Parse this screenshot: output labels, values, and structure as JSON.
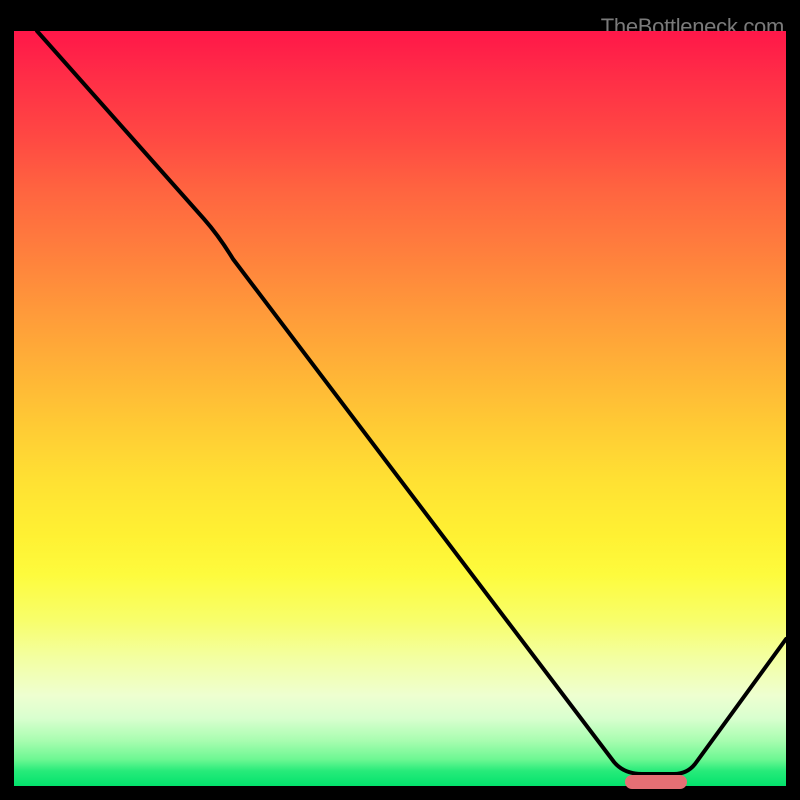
{
  "attribution": "TheBottleneck.com",
  "colors": {
    "curve": "#000000",
    "marker": "#e56f74",
    "gradient_top": "#ff1749",
    "gradient_bottom": "#03e26c"
  },
  "chart_data": {
    "type": "line",
    "title": "",
    "xlabel": "",
    "ylabel": "",
    "xlim": [
      0,
      100
    ],
    "ylim": [
      0,
      100
    ],
    "series": [
      {
        "name": "bottleneck-curve",
        "x": [
          3,
          25,
          80,
          86,
          100
        ],
        "values": [
          100,
          75,
          2,
          2,
          21
        ]
      }
    ],
    "marker": {
      "x_start": 79,
      "x_end": 87,
      "y": 1.5
    },
    "gradient_stops": [
      {
        "pct": 0,
        "color": "#ff1749"
      },
      {
        "pct": 25,
        "color": "#ff7e3d"
      },
      {
        "pct": 50,
        "color": "#ffcd34"
      },
      {
        "pct": 75,
        "color": "#f8fe6a"
      },
      {
        "pct": 95,
        "color": "#6cf792"
      },
      {
        "pct": 100,
        "color": "#03e26c"
      }
    ]
  }
}
